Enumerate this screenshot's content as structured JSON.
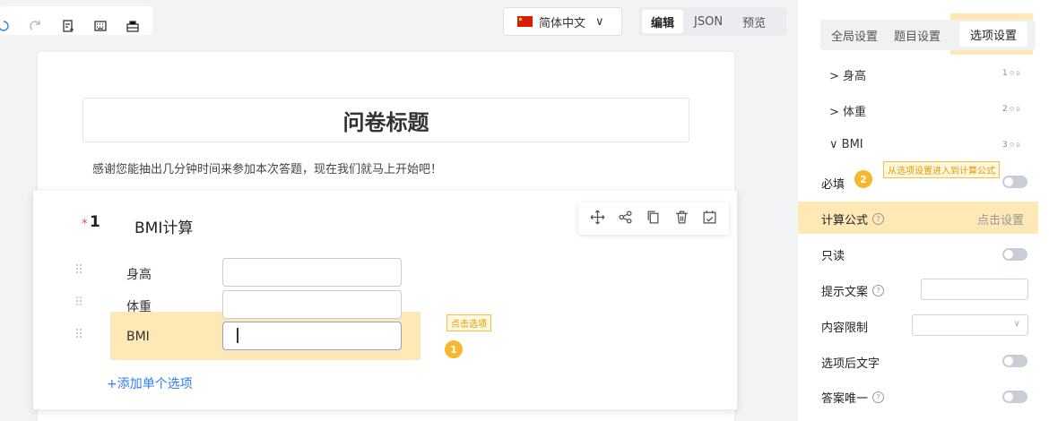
{
  "toolbar": {
    "icons": [
      "undo-icon",
      "redo-icon",
      "import-icon",
      "keyboard-icon",
      "layout-icon"
    ]
  },
  "language": {
    "flag": "cn-flag",
    "label": "简体中文",
    "caret": "∨"
  },
  "mode_tabs": [
    {
      "label": "编辑",
      "active": true
    },
    {
      "label": "JSON",
      "active": false
    },
    {
      "label": "预览",
      "active": false
    }
  ],
  "survey": {
    "title": "问卷标题",
    "description": "感谢您能抽出几分钟时间来参加本次答题，现在我们就马上开始吧！"
  },
  "question": {
    "required_mark": "*",
    "number": "1",
    "title": "BMI计算",
    "tools": [
      "move-icon",
      "logic-icon",
      "copy-icon",
      "delete-icon",
      "settings-icon"
    ],
    "options": [
      {
        "label": "身高"
      },
      {
        "label": "体重"
      },
      {
        "label": "BMI"
      }
    ],
    "add_option": "+添加单个选项"
  },
  "annotations": {
    "click_option": "点击选项",
    "badge_1": "1",
    "enter_formula": "从选项设置进入到计算公式",
    "badge_2": "2"
  },
  "panel": {
    "tabs": [
      "全局设置",
      "题目设置",
      "选项设置"
    ],
    "active_tab": "选项设置",
    "tree": [
      {
        "arrow": ">",
        "label": "身高",
        "num": "1"
      },
      {
        "arrow": ">",
        "label": "体重",
        "num": "2"
      },
      {
        "arrow": "∨",
        "label": "BMI",
        "num": "3"
      }
    ],
    "props": {
      "required": "必填",
      "formula": "计算公式",
      "formula_action": "点击设置",
      "readonly": "只读",
      "hint": "提示文案",
      "content_limit": "内容限制",
      "suffix": "选项后文字",
      "unique": "答案唯一"
    },
    "help_glyph": "?",
    "select_caret": "∨"
  },
  "colors": {
    "accent": "#2f7df7",
    "highlight": "#fde8b6",
    "badge": "#f5b82e",
    "required": "#e54545"
  }
}
